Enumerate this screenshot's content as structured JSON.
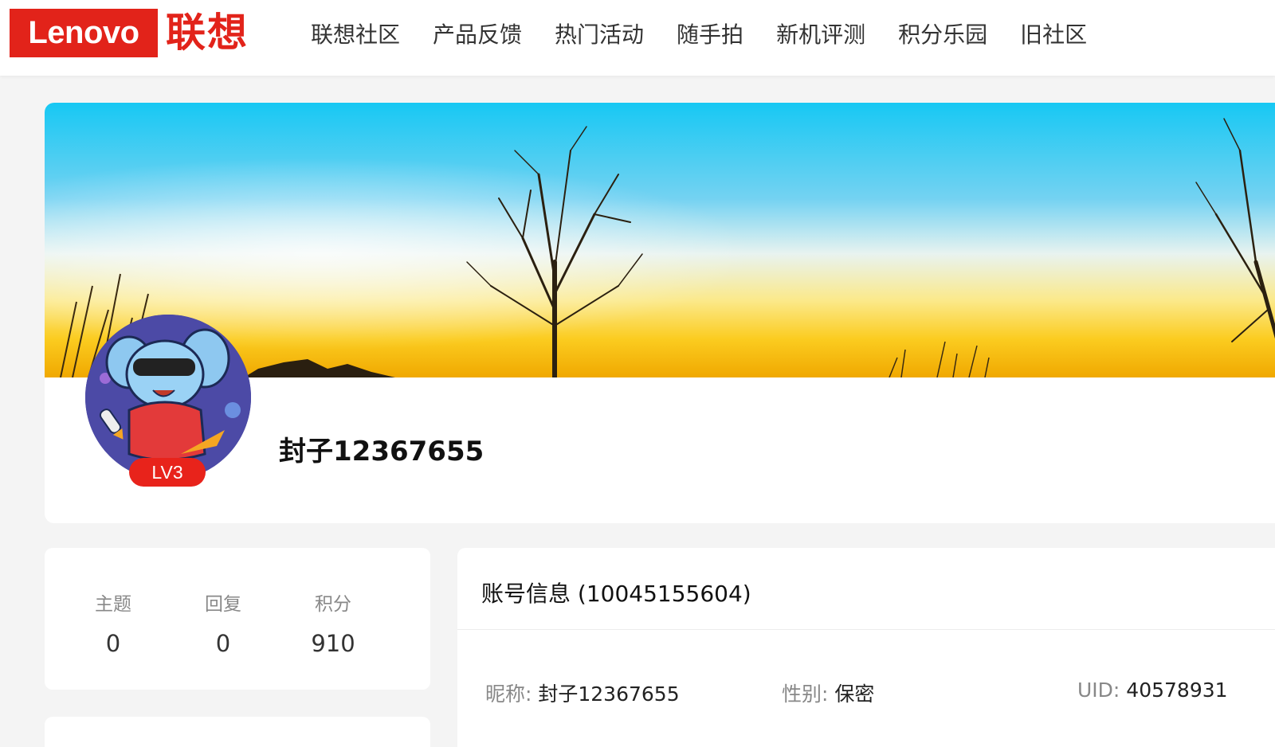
{
  "header": {
    "logo_en": "Lenovo",
    "logo_cn": "联想",
    "nav": [
      "联想社区",
      "产品反馈",
      "热门活动",
      "随手拍",
      "新机评测",
      "积分乐园",
      "旧社区"
    ]
  },
  "profile": {
    "level": "LV3",
    "username": "封子12367655"
  },
  "stats": [
    {
      "label": "主题",
      "value": "0"
    },
    {
      "label": "回复",
      "value": "0"
    },
    {
      "label": "积分",
      "value": "910"
    }
  ],
  "account": {
    "title": "账号信息 (10045155604)",
    "nickname_label": "昵称: ",
    "nickname": "封子12367655",
    "gender_label": "性别: ",
    "gender": "保密",
    "uid_label": "UID: ",
    "uid": "40578931"
  },
  "colors": {
    "brand": "#e2231a",
    "badge": "#e8231b"
  },
  "icons": [
    "lenovo-logo",
    "avatar-elephant-icon"
  ]
}
